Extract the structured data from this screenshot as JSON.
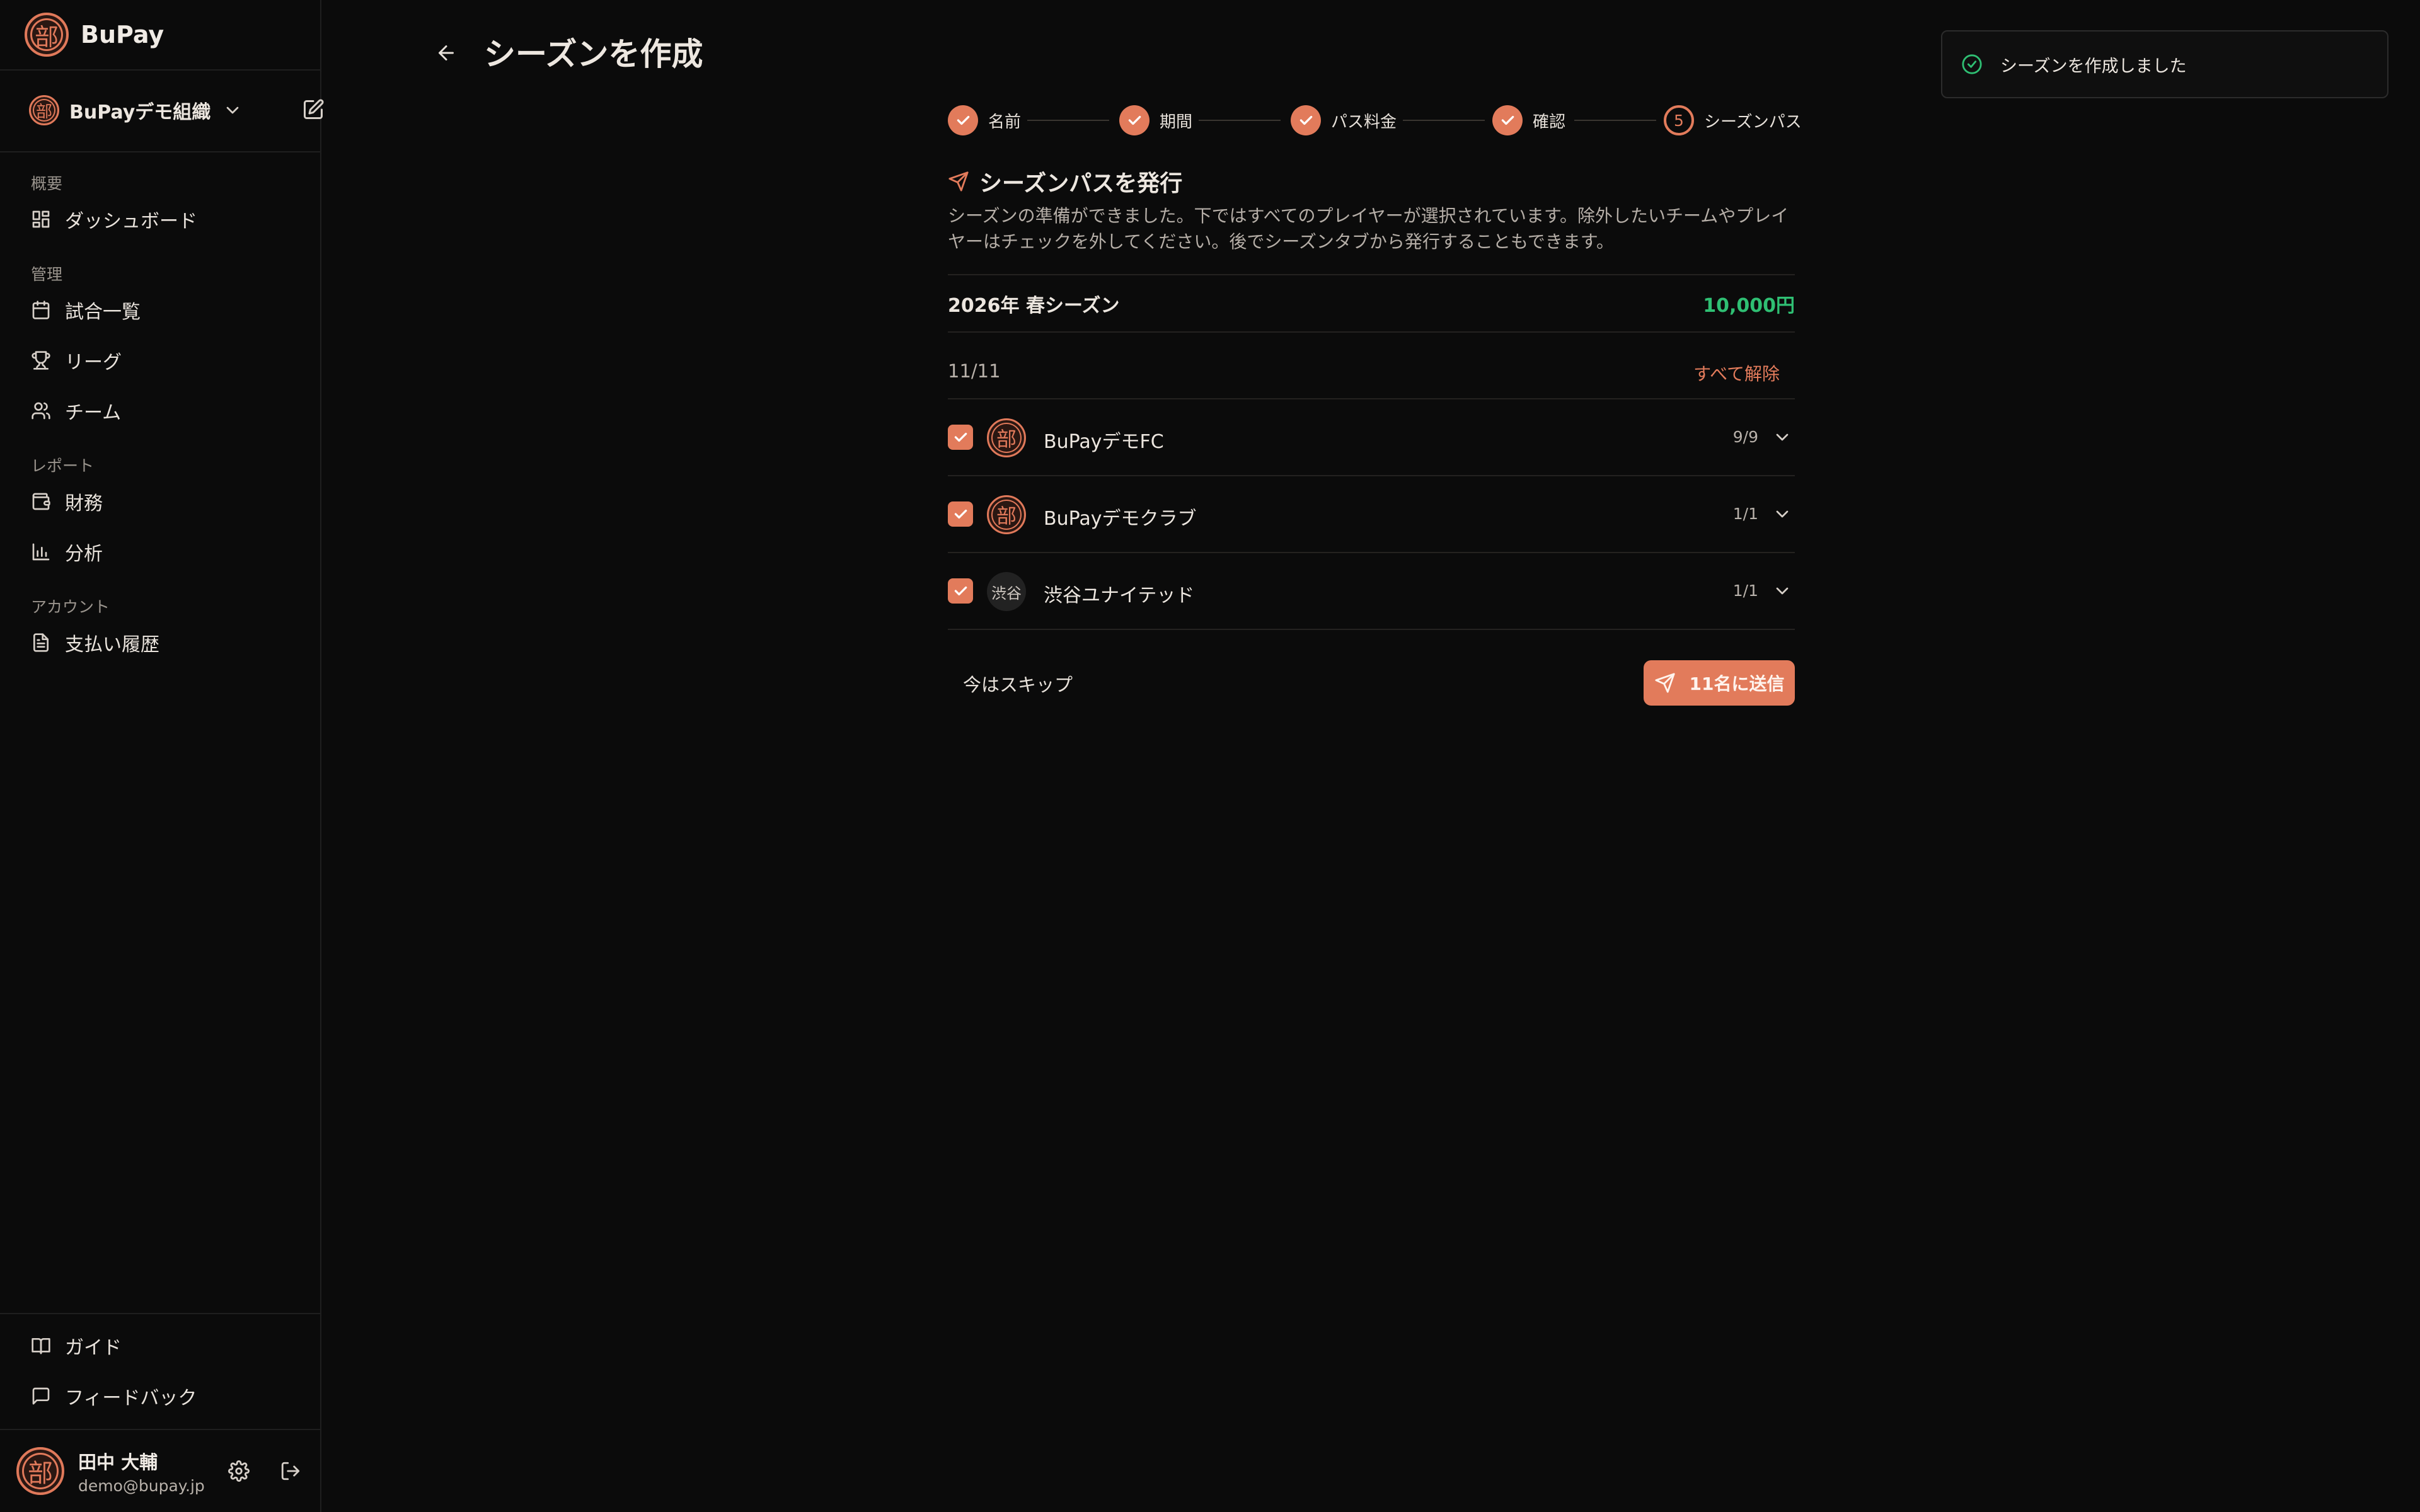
{
  "app": {
    "name": "BuPay",
    "logo_char": "部"
  },
  "org": {
    "name": "BuPayデモ組織"
  },
  "nav": {
    "sections": [
      {
        "label": "概要",
        "items": [
          {
            "label": "ダッシュボード",
            "icon": "dashboard-icon"
          }
        ]
      },
      {
        "label": "管理",
        "items": [
          {
            "label": "試合一覧",
            "icon": "calendar-icon"
          },
          {
            "label": "リーグ",
            "icon": "trophy-icon"
          },
          {
            "label": "チーム",
            "icon": "users-icon"
          }
        ]
      },
      {
        "label": "レポート",
        "items": [
          {
            "label": "財務",
            "icon": "wallet-icon"
          },
          {
            "label": "分析",
            "icon": "bar-chart-icon"
          }
        ]
      },
      {
        "label": "アカウント",
        "items": [
          {
            "label": "支払い履歴",
            "icon": "receipt-icon"
          }
        ]
      }
    ],
    "footer": [
      {
        "label": "ガイド",
        "icon": "book-icon"
      },
      {
        "label": "フィードバック",
        "icon": "message-icon"
      }
    ]
  },
  "user": {
    "name": "田中 大輔",
    "email": "demo@bupay.jp"
  },
  "header": {
    "title": "シーズンを作成"
  },
  "stepper": {
    "steps": [
      {
        "label": "名前",
        "state": "done"
      },
      {
        "label": "期間",
        "state": "done"
      },
      {
        "label": "パス料金",
        "state": "done"
      },
      {
        "label": "確認",
        "state": "done"
      },
      {
        "label": "シーズンパス",
        "state": "current",
        "number": "5"
      }
    ]
  },
  "main": {
    "title": "シーズンパスを発行",
    "description": "シーズンの準備ができました。下ではすべてのプレイヤーが選択されています。除外したいチームやプレイヤーはチェックを外してください。後でシーズンタブから発行することもできます。",
    "season": {
      "name": "2026年 春シーズン",
      "price": "10,000円"
    },
    "selection_count": "11/11",
    "clear_all": "すべて解除",
    "teams": [
      {
        "name": "BuPayデモFC",
        "count": "9/9",
        "avatar": "部",
        "avatar_type": "badge",
        "checked": true
      },
      {
        "name": "BuPayデモクラブ",
        "count": "1/1",
        "avatar": "部",
        "avatar_type": "badge",
        "checked": true
      },
      {
        "name": "渋谷ユナイテッド",
        "count": "1/1",
        "avatar": "渋谷",
        "avatar_type": "text",
        "checked": true
      }
    ],
    "skip_label": "今はスキップ",
    "send_label": "11名に送信"
  },
  "toast": {
    "message": "シーズンを作成しました"
  },
  "colors": {
    "accent": "#e27b5b",
    "price": "#2fbf73",
    "background": "#0b0b0b"
  }
}
